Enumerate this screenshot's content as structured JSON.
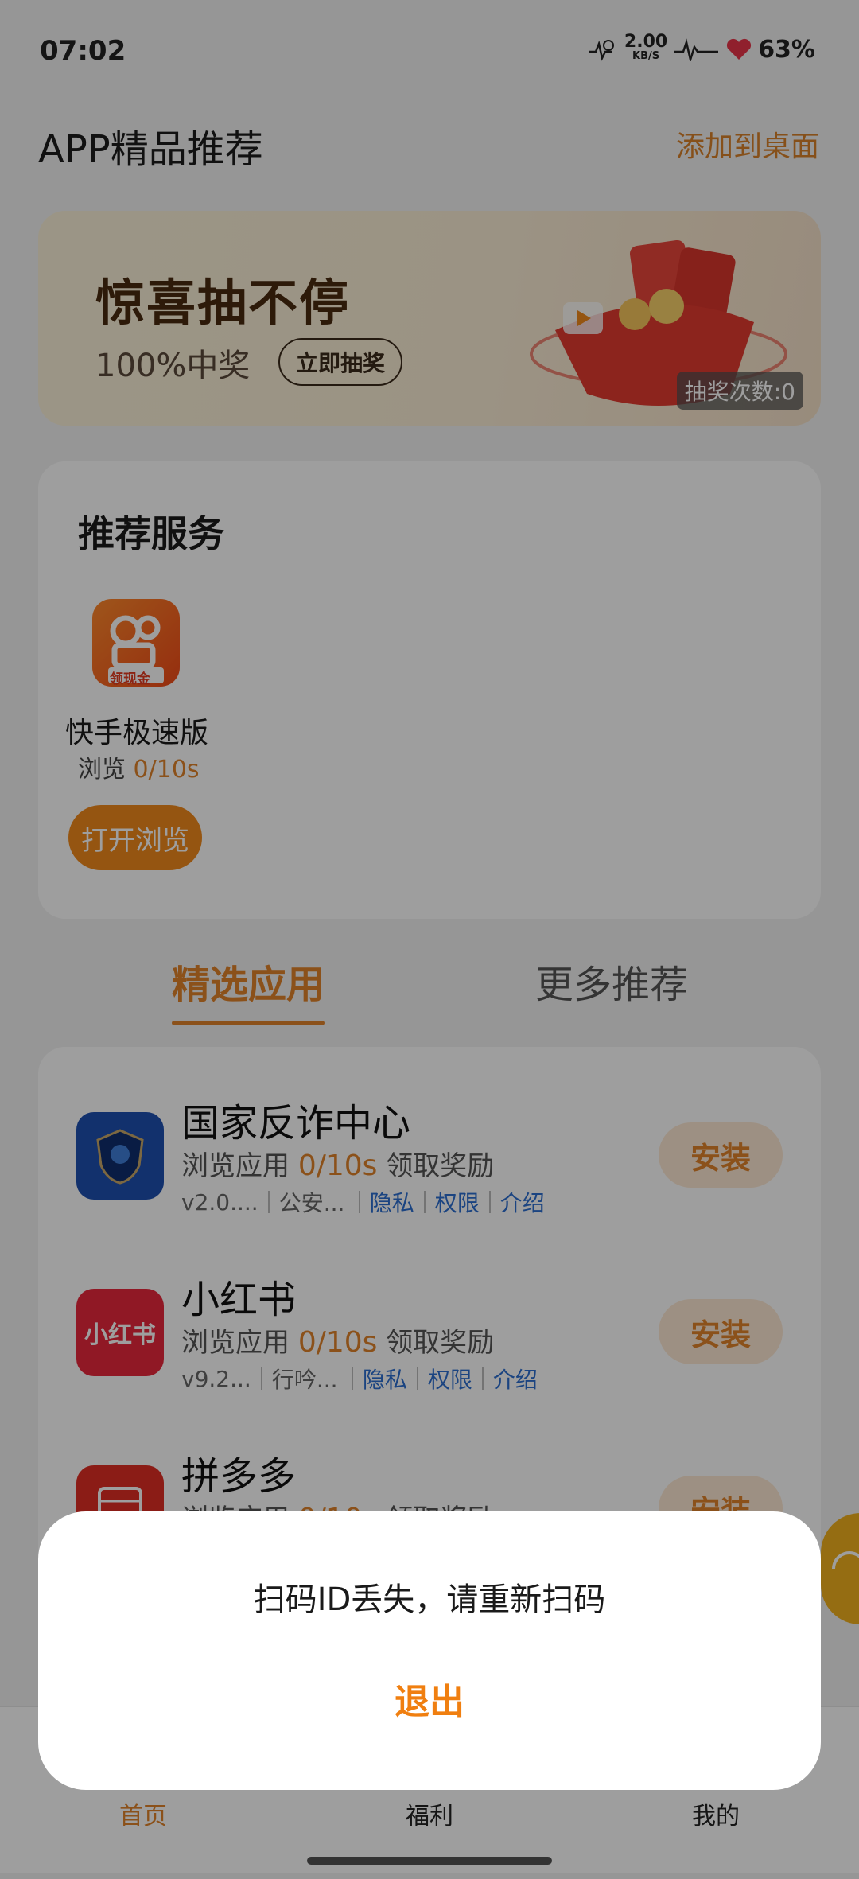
{
  "status_bar": {
    "time": "07:02",
    "speed_value": "2.00",
    "speed_unit": "KB/S",
    "battery": "63%"
  },
  "header": {
    "title": "APP精品推荐",
    "add_to_desktop": "添加到桌面"
  },
  "banner": {
    "title": "惊喜抽不停",
    "subtitle": "100%中奖",
    "button": "立即抽奖",
    "draw_count": "抽奖次数:0"
  },
  "recommend": {
    "title": "推荐服务",
    "app_name": "快手极速版",
    "browse_label": "浏览",
    "browse_progress": "0/10s",
    "icon_badge": "领现金",
    "button": "打开浏览"
  },
  "tabs": {
    "active": "精选应用",
    "inactive": "更多推荐"
  },
  "apps": [
    {
      "name": "国家反诈中心",
      "stat_prefix": "浏览应用",
      "progress": "0/10s",
      "stat_suffix": "领取奖励",
      "version": "v2.0....",
      "developer": "公安...",
      "privacy": "隐私",
      "permission": "权限",
      "intro": "介绍",
      "install": "安装",
      "icon_color": "#1d4fb0"
    },
    {
      "name": "小红书",
      "stat_prefix": "浏览应用",
      "progress": "0/10s",
      "stat_suffix": "领取奖励",
      "version": "v9.2...",
      "developer": "行吟...",
      "privacy": "隐私",
      "permission": "权限",
      "intro": "介绍",
      "install": "安装",
      "icon_text": "小红书",
      "icon_color": "#e8283c"
    },
    {
      "name": "拼多多",
      "stat_prefix": "浏览应用",
      "progress": "0/10s",
      "stat_suffix": "领取奖励",
      "install": "安装",
      "icon_color": "#e02e24"
    }
  ],
  "bottom_nav": {
    "home": "首页",
    "welfare": "福利",
    "mine": "我的"
  },
  "dialog": {
    "message": "扫码ID丢失，请重新扫码",
    "button": "退出"
  },
  "colors": {
    "accent": "#e0832a",
    "link": "#2d6fd0",
    "overlay": "rgba(0,0,0,0.38)"
  }
}
